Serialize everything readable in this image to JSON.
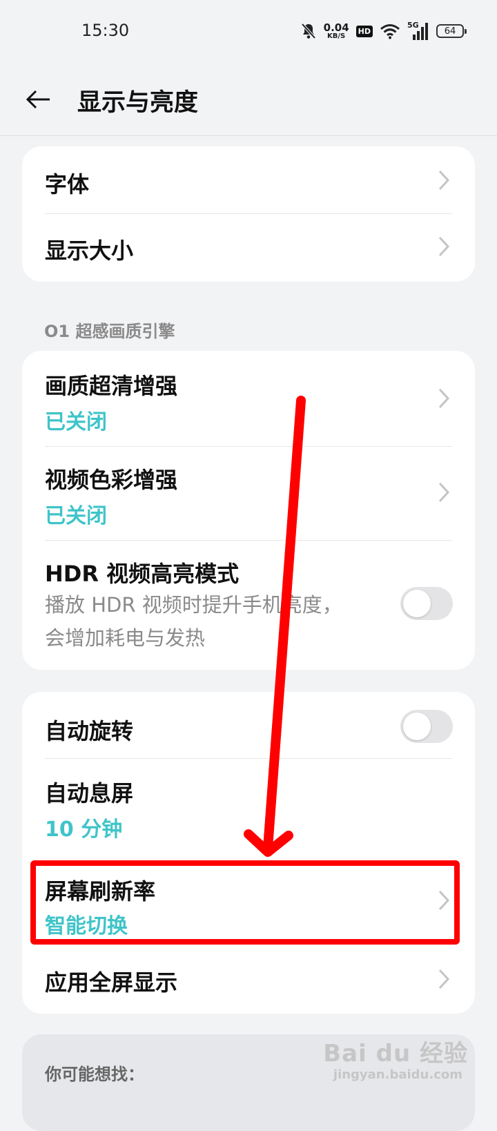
{
  "status_bar": {
    "time": "15:30",
    "speed_value": "0.04",
    "speed_unit": "KB/S",
    "hd": "HD",
    "network": "5G",
    "battery": "64"
  },
  "header": {
    "title": "显示与亮度"
  },
  "card1": {
    "items": [
      {
        "label": "字体"
      },
      {
        "label": "显示大小"
      }
    ]
  },
  "section": {
    "label": "O1 超感画质引擎"
  },
  "card2": {
    "items": [
      {
        "label": "画质超清增强",
        "value": "已关闭"
      },
      {
        "label": "视频色彩增强",
        "value": "已关闭"
      },
      {
        "label": "HDR 视频高亮模式",
        "desc_line1": "播放 HDR 视频时提升手机亮度，",
        "desc_line2": "会增加耗电与发热"
      }
    ]
  },
  "card3": {
    "items": [
      {
        "label": "自动旋转"
      },
      {
        "label": "自动息屏",
        "value": "10 分钟"
      },
      {
        "label": "屏幕刷新率",
        "value": "智能切换"
      },
      {
        "label": "应用全屏显示"
      }
    ]
  },
  "suggestions": {
    "label": "你可能想找："
  },
  "watermark": {
    "brand": "Bai du 经验",
    "site": "jingyan.baidu.com"
  },
  "colors": {
    "accent": "#3fc4c9",
    "annotation": "#ff0000",
    "background": "#f2f3f5"
  }
}
